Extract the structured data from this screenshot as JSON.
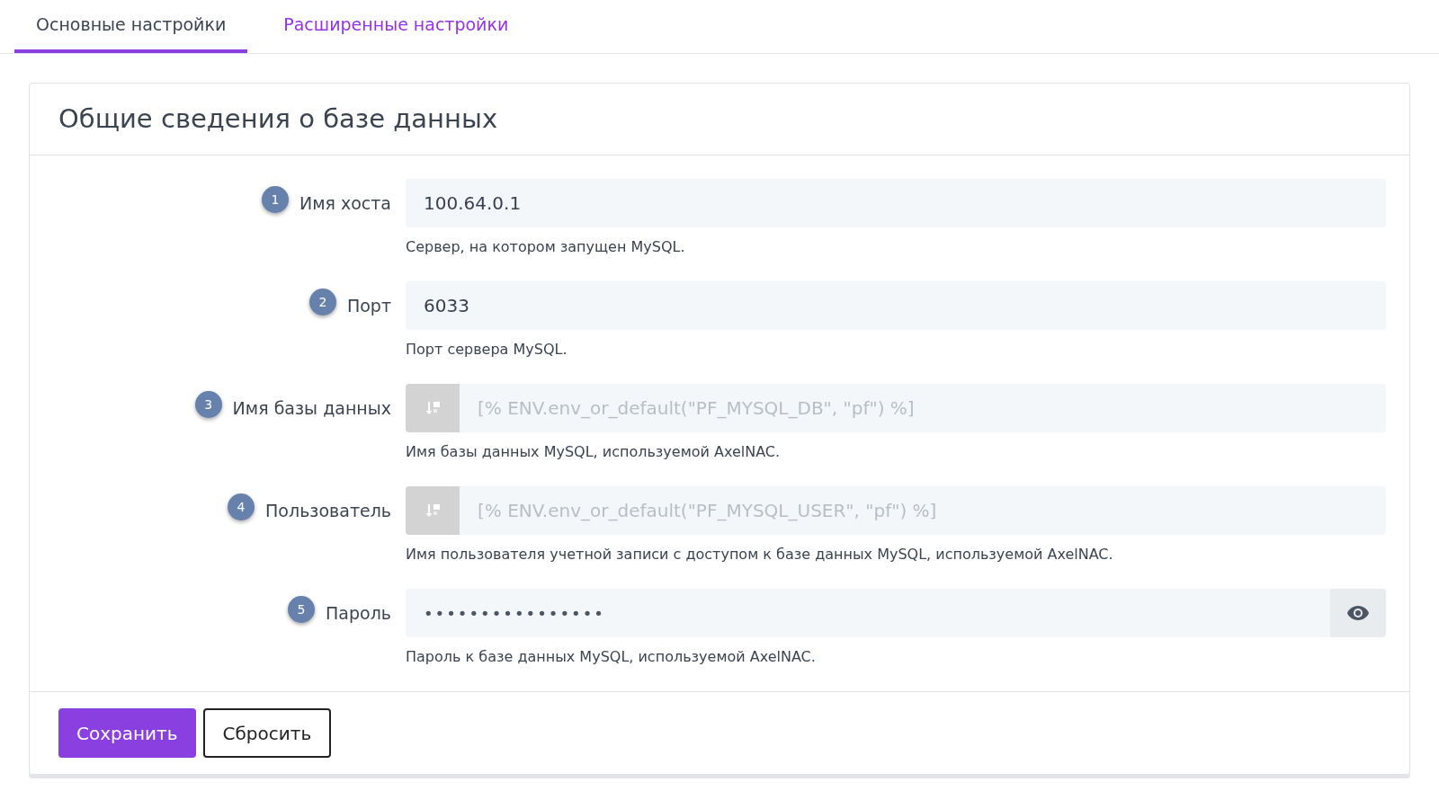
{
  "tabs": [
    {
      "label": "Основные настройки",
      "selected": true
    },
    {
      "label": "Расширенные настройки",
      "selected": false
    }
  ],
  "card": {
    "title": "Общие сведения о базе данных",
    "fields": [
      {
        "kind": "text",
        "step": "1",
        "label": "Имя хоста",
        "value": "100.64.0.1",
        "help": "Сервер, на котором запущен MySQL."
      },
      {
        "kind": "text",
        "step": "2",
        "label": "Порт",
        "value": "6033",
        "help": "Порт сервера MySQL."
      },
      {
        "kind": "env",
        "step": "3",
        "label": "Имя базы данных",
        "placeholder": "[% ENV.env_or_default(\"PF_MYSQL_DB\", \"pf\") %]",
        "help": "Имя базы данных MySQL, используемой AxelNAC."
      },
      {
        "kind": "env",
        "step": "4",
        "label": "Пользователь",
        "placeholder": "[% ENV.env_or_default(\"PF_MYSQL_USER\", \"pf\") %]",
        "help": "Имя пользователя учетной записи с доступом к базе данных MySQL, используемой AxelNAC."
      },
      {
        "kind": "password",
        "step": "5",
        "label": "Пароль",
        "value": "••••••••••••••••",
        "help": "Пароль к базе данных MySQL, используемой AxelNAC."
      }
    ],
    "buttons": [
      {
        "kind": "primary",
        "label": "Сохранить"
      },
      {
        "kind": "outline",
        "label": "Сбросить"
      }
    ]
  }
}
